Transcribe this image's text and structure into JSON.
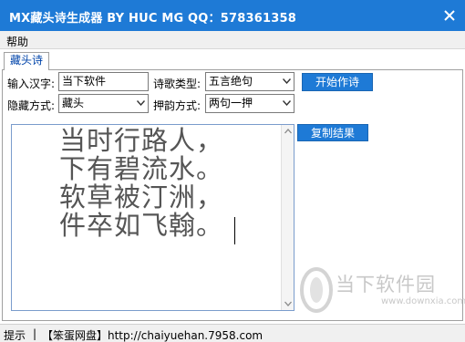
{
  "window": {
    "title": "MX藏头诗生成器 BY HUC MG QQ：578361358"
  },
  "menu": {
    "help": "帮助"
  },
  "tabs": [
    {
      "label": "藏头诗",
      "active": true
    }
  ],
  "form": {
    "input_label": "输入汉字:",
    "input_value": "当下软件",
    "poem_type_label": "诗歌类型:",
    "poem_type_value": "五言绝句",
    "hide_mode_label": "隐藏方式:",
    "hide_mode_value": "藏头",
    "rhyme_mode_label": "押韵方式:",
    "rhyme_mode_value": "两句一押",
    "start_button": "开始作诗",
    "copy_button": "复制结果"
  },
  "output": {
    "lines": [
      "当时行路人，",
      "下有碧流水。",
      "软草被汀洲，",
      "件卒如飞翰。"
    ]
  },
  "watermark": {
    "name": "当下软件园",
    "url": "www.downxia.com"
  },
  "statusbar": {
    "label": "提示",
    "separator": "|",
    "text": "【笨蛋网盘】http://chaiyuehan.7958.com"
  },
  "colors": {
    "accent": "#1e7ad6",
    "poem_text": "#555555",
    "watermark": "#c8c8c8"
  },
  "icons": {
    "close": "close-icon",
    "dropdown": "chevron-down-icon",
    "scroll_up": "scroll-up-icon",
    "scroll_down": "scroll-down-icon",
    "logo": "downxia-logo-icon"
  }
}
